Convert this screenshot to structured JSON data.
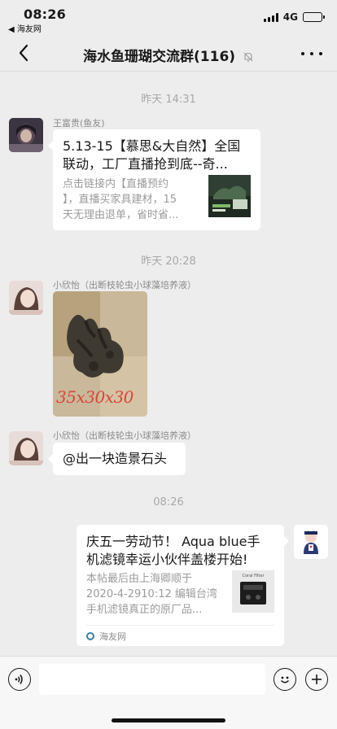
{
  "status": {
    "time": "08:26",
    "back_app": "◀ 海友网",
    "network": "4G"
  },
  "nav": {
    "title": "海水鱼珊瑚交流群(116)"
  },
  "messages": [
    {
      "type": "timestamp",
      "text": "昨天 14:31"
    },
    {
      "type": "link_card",
      "sender": "王富贵(鱼友)",
      "title": "5.13-15【慕思&大自然】全国联动，工厂直播抢到底--奇...",
      "title_line1": "5.13-15【慕思&大自然】全国",
      "title_line2": "联动，工厂直播抢到底--奇...",
      "desc_line1": "点击链接内【直播预约",
      "desc_line2": "】，直播买家具建材，15",
      "desc_line3": "天无理由退单，省时省..."
    },
    {
      "type": "timestamp",
      "text": "昨天 20:28"
    },
    {
      "type": "image",
      "sender": "小欣怡（出断枝轮虫小球藻培养液）",
      "image_caption": "35x30x30"
    },
    {
      "type": "text",
      "sender": "小欣怡（出断枝轮虫小球藻培养液）",
      "text": "@出一块造景石头"
    },
    {
      "type": "timestamp",
      "text": "08:26"
    },
    {
      "type": "link_card_self",
      "title_line1": "庆五一劳动节！ Aqua blue手",
      "title_line2": "机滤镜幸运小伙伴盖楼开始!",
      "desc_line1": "本帖最后由上海卿顺于",
      "desc_line2": "2020-4-2910:12 编辑台湾",
      "desc_line3": "手机滤镜真正的原厂品...",
      "thumb_label": "Coral Filter",
      "source": "海友网"
    }
  ],
  "input": {
    "placeholder": ""
  },
  "colors": {
    "background": "#ededed",
    "bubble": "#ffffff",
    "timestamp": "#a8a8a8",
    "source_icon": "#3d7f9b"
  }
}
